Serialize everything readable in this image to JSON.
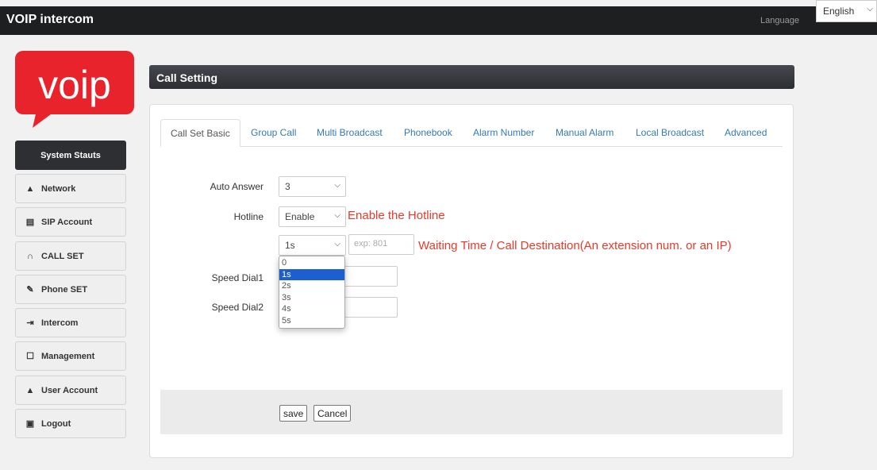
{
  "topbar": {
    "title": "VOIP intercom",
    "language_label": "Language",
    "language_value": "English"
  },
  "logo": {
    "text": "voip",
    "color": "#e8232b"
  },
  "sidebar": {
    "items": [
      {
        "label": "System Stauts",
        "icon": ""
      },
      {
        "label": "Network",
        "icon": "network-icon"
      },
      {
        "label": "SIP Account",
        "icon": "book-icon"
      },
      {
        "label": "CALL SET",
        "icon": "headset-icon"
      },
      {
        "label": "Phone SET",
        "icon": "pencil-icon"
      },
      {
        "label": "Intercom",
        "icon": "sign-in-icon"
      },
      {
        "label": "Management",
        "icon": "edit-icon"
      },
      {
        "label": "User Account",
        "icon": "user-icon"
      },
      {
        "label": "Logout",
        "icon": "lock-icon"
      }
    ]
  },
  "page": {
    "title": "Call Setting"
  },
  "tabs": [
    "Call Set Basic",
    "Group Call",
    "Multi Broadcast",
    "Phonebook",
    "Alarm Number",
    "Manual Alarm",
    "Local Broadcast",
    "Advanced"
  ],
  "form": {
    "auto_answer_label": "Auto Answer",
    "auto_answer_value": "3",
    "hotline_label": "Hotline",
    "hotline_value": "Enable",
    "hotline_annotation": "Enable the Hotline",
    "wait_value": "1s",
    "destination_placeholder": "exp: 801",
    "wait_annotation": "Waiting Time / Call Destination(An extension num. or an IP)",
    "speed_dial1_label": "Speed Dial1",
    "speed_dial2_label": "Speed Dial2",
    "wait_options": [
      "0",
      "1s",
      "2s",
      "3s",
      "4s",
      "5s"
    ]
  },
  "buttons": {
    "save": "save",
    "cancel": "Cancel"
  },
  "colors": {
    "accent": "#337ab7",
    "annotation": "#e53b2c",
    "topbar": "#1e1f21"
  }
}
